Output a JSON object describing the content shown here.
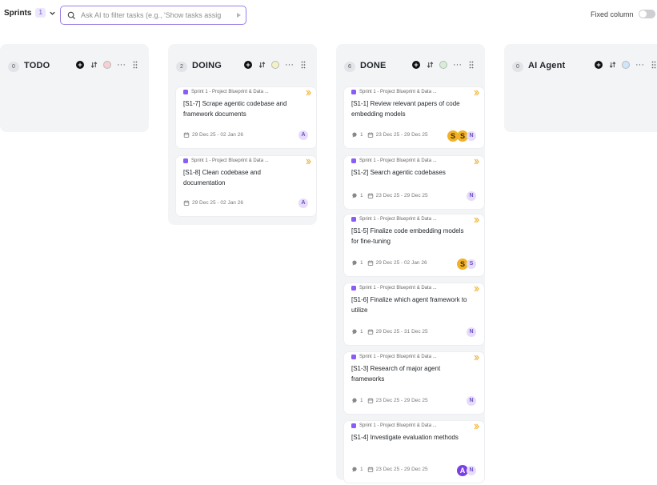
{
  "toolbar": {
    "sprints_label": "Sprints",
    "sprints_count": "1",
    "search_placeholder": "Ask AI to filter tasks (e.g., 'Show tasks assig",
    "fixed_column_label": "Fixed column"
  },
  "columns": [
    {
      "title": "TODO",
      "count": "0",
      "dot_color": "#f8cfd2",
      "cards": []
    },
    {
      "title": "DOING",
      "count": "2",
      "dot_color": "#f2f3c4",
      "cards": [
        {
          "sprint": "Sprint 1 - Project Blueprint & Data ...",
          "title": "[S1-7] Scrape agentic codebase and framework documents",
          "comments": "",
          "dates": "29 Dec 25 - 02 Jan 26",
          "avatars": [
            {
              "label": "A",
              "style": "light"
            }
          ]
        },
        {
          "sprint": "Sprint 1 - Project Blueprint & Data ...",
          "title": "[S1-8] Clean codebase and documentation",
          "comments": "",
          "dates": "29 Dec 25 - 02 Jan 26",
          "avatars": [
            {
              "label": "A",
              "style": "light"
            }
          ]
        }
      ]
    },
    {
      "title": "DONE",
      "count": "6",
      "dot_color": "#d6efd4",
      "cards": [
        {
          "sprint": "Sprint 1 - Project Blueprint & Data ...",
          "title": "[S1-1] Review relevant papers of code embedding models",
          "comments": "1",
          "dates": "23 Dec 25 - 29 Dec 25",
          "avatars": [
            {
              "label": "S",
              "style": "s"
            },
            {
              "label": "S",
              "style": "s2"
            },
            {
              "label": "N",
              "style": "light"
            }
          ]
        },
        {
          "sprint": "Sprint 1 - Project Blueprint & Data ...",
          "title": "[S1-2] Search agentic codebases",
          "comments": "1",
          "dates": "23 Dec 25 - 29 Dec 25",
          "avatars": [
            {
              "label": "N",
              "style": "light"
            }
          ]
        },
        {
          "sprint": "Sprint 1 - Project Blueprint & Data ...",
          "title": "[S1-5] Finalize code embedding models for fine-tuning",
          "comments": "1",
          "dates": "29 Dec 25 - 02 Jan 26",
          "avatars": [
            {
              "label": "S",
              "style": "s"
            },
            {
              "label": "S",
              "style": "light"
            }
          ]
        },
        {
          "sprint": "Sprint 1 - Project Blueprint & Data ...",
          "title": "[S1-6] Finalize which agent framework to utilize",
          "comments": "1",
          "dates": "29 Dec 25 - 31 Dec 25",
          "avatars": [
            {
              "label": "N",
              "style": "light"
            }
          ]
        },
        {
          "sprint": "Sprint 1 - Project Blueprint & Data ...",
          "title": "[S1-3] Research of major agent frameworks",
          "comments": "1",
          "dates": "23 Dec 25 - 29 Dec 25",
          "avatars": [
            {
              "label": "N",
              "style": "light"
            }
          ]
        },
        {
          "sprint": "Sprint 1 - Project Blueprint & Data ...",
          "title": "[S1-4] Investigate evaluation methods",
          "comments": "1",
          "dates": "23 Dec 25 - 29 Dec 25",
          "avatars": [
            {
              "label": "A",
              "style": "a-dark"
            },
            {
              "label": "N",
              "style": "light"
            }
          ]
        }
      ]
    },
    {
      "title": "AI Agent",
      "count": "0",
      "dot_color": "#cde6fb",
      "cards": []
    }
  ]
}
